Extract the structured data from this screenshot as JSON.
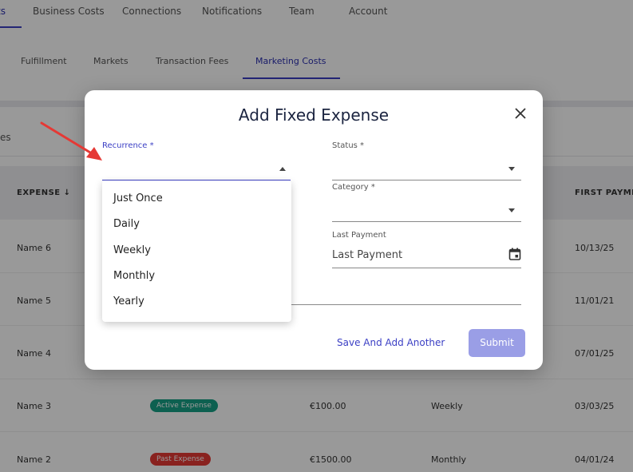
{
  "top_tabs": {
    "items": [
      {
        "label": "ts"
      },
      {
        "label": "Business Costs"
      },
      {
        "label": "Connections"
      },
      {
        "label": "Notifications"
      },
      {
        "label": "Team"
      },
      {
        "label": "Account"
      }
    ]
  },
  "sub_tabs": {
    "items": [
      {
        "label": "Fulfillment"
      },
      {
        "label": "Markets"
      },
      {
        "label": "Transaction Fees"
      },
      {
        "label": "Marketing Costs"
      }
    ]
  },
  "filter": {
    "partial_text": "es"
  },
  "table": {
    "headers": {
      "expense": "EXPENSE ↓",
      "first_payment": "FIRST PAYME"
    },
    "rows": [
      {
        "name": "Name 6",
        "status": "",
        "amount": "",
        "recurrence": "",
        "first_payment": "10/13/25"
      },
      {
        "name": "Name 5",
        "status": "",
        "amount": "",
        "recurrence": "",
        "first_payment": "11/01/21"
      },
      {
        "name": "Name 4",
        "status": "",
        "amount": "",
        "recurrence": "",
        "first_payment": "07/01/25"
      },
      {
        "name": "Name 3",
        "status": "Active Expense",
        "amount": "€100.00",
        "recurrence": "Weekly",
        "first_payment": "03/03/25"
      },
      {
        "name": "Name 2",
        "status": "Past Expense",
        "amount": "€1500.00",
        "recurrence": "Monthly",
        "first_payment": "04/01/24"
      }
    ]
  },
  "modal": {
    "title": "Add Fixed Expense",
    "recurrence": {
      "label": "Recurrence *",
      "value": ""
    },
    "status": {
      "label": "Status *",
      "value": ""
    },
    "category": {
      "label": "Category *",
      "value": ""
    },
    "last_payment": {
      "label": "Last Payment",
      "placeholder": "Last Payment"
    },
    "recurrence_options": [
      "Just Once",
      "Daily",
      "Weekly",
      "Monthly",
      "Yearly"
    ],
    "save_another_label": "Save And Add Another",
    "submit_label": "Submit"
  },
  "colors": {
    "accent": "#3b3fc4",
    "submit_disabled": "#9a9ee6",
    "annotation_arrow": "#e53935",
    "badge_active": "#16a085",
    "badge_past": "#e53935"
  }
}
